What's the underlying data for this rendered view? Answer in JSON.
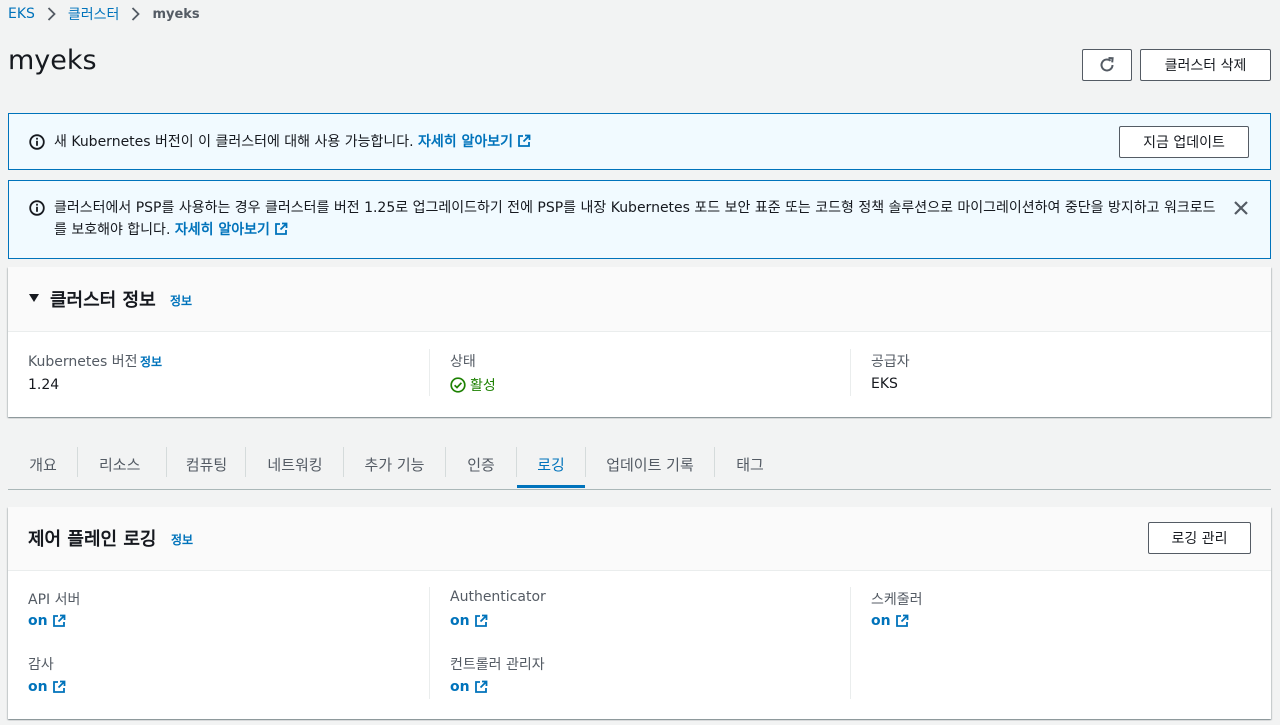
{
  "breadcrumb": {
    "items": [
      "EKS",
      "클러스터"
    ],
    "current": "myeks"
  },
  "page": {
    "title": "myeks",
    "delete_button": "클러스터 삭제"
  },
  "flash_update": {
    "message": "새 Kubernetes 버전이 이 클러스터에 대해 사용 가능합니다.",
    "learn_more": "자세히 알아보기",
    "button": "지금 업데이트"
  },
  "flash_psp": {
    "message": "클러스터에서 PSP를 사용하는 경우 클러스터를 버전 1.25로 업그레이드하기 전에 PSP를 내장 Kubernetes 포드 보안 표준 또는 코드형 정책 솔루션으로 마이그레이션하여 중단을 방지하고 워크로드를 보호해야 합니다.",
    "learn_more": "자세히 알아보기"
  },
  "cluster_info": {
    "title": "클러스터 정보",
    "info_link": "정보",
    "k8s_version_label": "Kubernetes 버전",
    "k8s_version_info": "정보",
    "k8s_version_value": "1.24",
    "status_label": "상태",
    "status_value": "활성",
    "provider_label": "공급자",
    "provider_value": "EKS"
  },
  "tabs": [
    "개요",
    "리소스",
    "컴퓨팅",
    "네트워킹",
    "추가 기능",
    "인증",
    "로깅",
    "업데이트 기록",
    "태그"
  ],
  "active_tab": "로깅",
  "logging": {
    "title": "제어 플레인 로깅",
    "info_link": "정보",
    "manage_button": "로깅 관리",
    "items": [
      {
        "label": "API 서버",
        "value": "on"
      },
      {
        "label": "Authenticator",
        "value": "on"
      },
      {
        "label": "스케줄러",
        "value": "on"
      },
      {
        "label": "감사",
        "value": "on"
      },
      {
        "label": "컨트롤러 관리자",
        "value": "on"
      }
    ]
  },
  "colors": {
    "link": "#0073bb",
    "success": "#1d8102",
    "info_bg": "#f1faff",
    "text_secondary": "#545b64"
  },
  "icons": [
    "chevron-right-icon",
    "refresh-icon",
    "info-icon",
    "external-link-icon",
    "close-icon",
    "caret-down-icon",
    "check-circle-icon"
  ]
}
